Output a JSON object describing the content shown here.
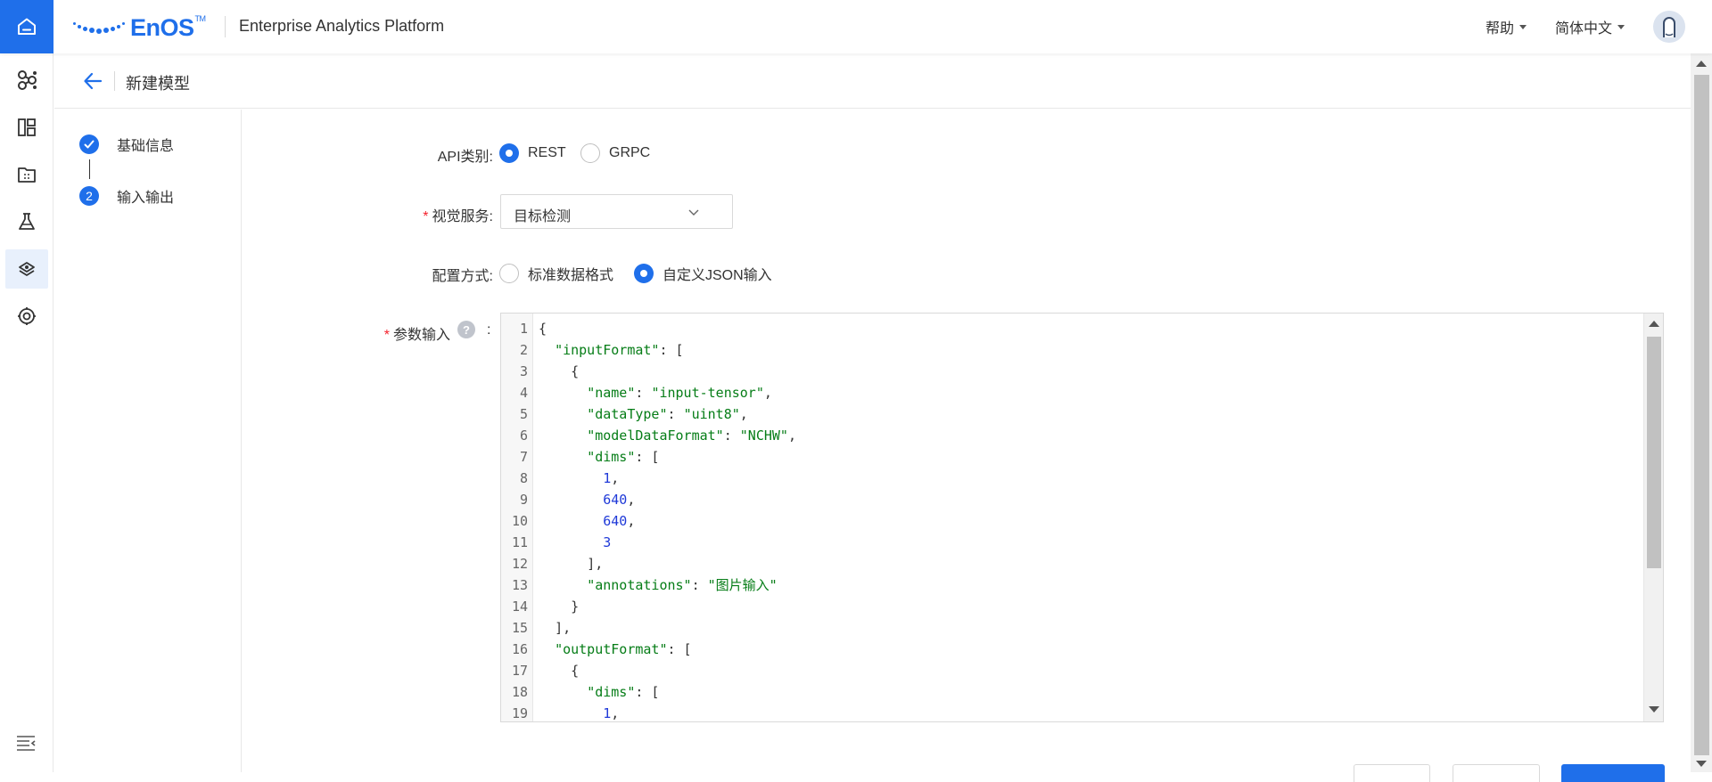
{
  "app": {
    "logo_text": "EnOS",
    "logo_tm": "TM",
    "platform_title": "Enterprise Analytics Platform",
    "help_label": "帮助",
    "language_label": "简体中文",
    "brand_color": "#1f6fea"
  },
  "rail": {
    "items": [
      {
        "icon": "home-icon"
      },
      {
        "icon": "model-network-icon"
      },
      {
        "icon": "dashboard-icon"
      },
      {
        "icon": "folder-icon"
      },
      {
        "icon": "flask-icon"
      },
      {
        "icon": "model-service-icon",
        "active": true
      },
      {
        "icon": "settings-icon"
      }
    ],
    "collapse_icon": "menu-collapse-icon"
  },
  "header": {
    "title": "新建模型"
  },
  "steps": [
    {
      "label": "基础信息",
      "status": "done"
    },
    {
      "label": "输入输出",
      "number": "2",
      "status": "current"
    }
  ],
  "form": {
    "api_type": {
      "label": "API类别",
      "colon": ":",
      "options": [
        "REST",
        "GRPC"
      ],
      "selected": "REST"
    },
    "vision_service": {
      "label": "视觉服务",
      "colon": ":",
      "value": "目标检测"
    },
    "config_mode": {
      "label": "配置方式",
      "colon": ":",
      "options": [
        "标准数据格式",
        "自定义JSON输入"
      ],
      "selected": "自定义JSON输入"
    },
    "params": {
      "label": "参数输入",
      "help": "?",
      "colon": ":"
    }
  },
  "editor": {
    "lines": [
      {
        "n": "1",
        "indent": "",
        "parts": [
          [
            "p",
            "{"
          ]
        ]
      },
      {
        "n": "2",
        "indent": "  ",
        "parts": [
          [
            "k",
            "\"inputFormat\""
          ],
          [
            "p",
            ": ["
          ]
        ]
      },
      {
        "n": "3",
        "indent": "    ",
        "parts": [
          [
            "p",
            "{"
          ]
        ]
      },
      {
        "n": "4",
        "indent": "      ",
        "parts": [
          [
            "k",
            "\"name\""
          ],
          [
            "p",
            ": "
          ],
          [
            "s",
            "\"input-tensor\""
          ],
          [
            "p",
            ","
          ]
        ]
      },
      {
        "n": "5",
        "indent": "      ",
        "parts": [
          [
            "k",
            "\"dataType\""
          ],
          [
            "p",
            ": "
          ],
          [
            "s",
            "\"uint8\""
          ],
          [
            "p",
            ","
          ]
        ]
      },
      {
        "n": "6",
        "indent": "      ",
        "parts": [
          [
            "k",
            "\"modelDataFormat\""
          ],
          [
            "p",
            ": "
          ],
          [
            "s",
            "\"NCHW\""
          ],
          [
            "p",
            ","
          ]
        ]
      },
      {
        "n": "7",
        "indent": "      ",
        "parts": [
          [
            "k",
            "\"dims\""
          ],
          [
            "p",
            ": ["
          ]
        ]
      },
      {
        "n": "8",
        "indent": "        ",
        "parts": [
          [
            "n",
            "1"
          ],
          [
            "p",
            ","
          ]
        ]
      },
      {
        "n": "9",
        "indent": "        ",
        "parts": [
          [
            "n",
            "640"
          ],
          [
            "p",
            ","
          ]
        ]
      },
      {
        "n": "10",
        "indent": "        ",
        "parts": [
          [
            "n",
            "640"
          ],
          [
            "p",
            ","
          ]
        ]
      },
      {
        "n": "11",
        "indent": "        ",
        "parts": [
          [
            "n",
            "3"
          ]
        ]
      },
      {
        "n": "12",
        "indent": "      ",
        "parts": [
          [
            "p",
            "],"
          ]
        ]
      },
      {
        "n": "13",
        "indent": "      ",
        "parts": [
          [
            "k",
            "\"annotations\""
          ],
          [
            "p",
            ": "
          ],
          [
            "s",
            "\"图片输入\""
          ]
        ]
      },
      {
        "n": "14",
        "indent": "    ",
        "parts": [
          [
            "p",
            "}"
          ]
        ]
      },
      {
        "n": "15",
        "indent": "  ",
        "parts": [
          [
            "p",
            "],"
          ]
        ]
      },
      {
        "n": "16",
        "indent": "  ",
        "parts": [
          [
            "k",
            "\"outputFormat\""
          ],
          [
            "p",
            ": ["
          ]
        ]
      },
      {
        "n": "17",
        "indent": "    ",
        "parts": [
          [
            "p",
            "{"
          ]
        ]
      },
      {
        "n": "18",
        "indent": "      ",
        "parts": [
          [
            "k",
            "\"dims\""
          ],
          [
            "p",
            ": ["
          ]
        ]
      },
      {
        "n": "19",
        "indent": "        ",
        "parts": [
          [
            "n",
            "1"
          ],
          [
            "p",
            ","
          ]
        ]
      }
    ]
  }
}
